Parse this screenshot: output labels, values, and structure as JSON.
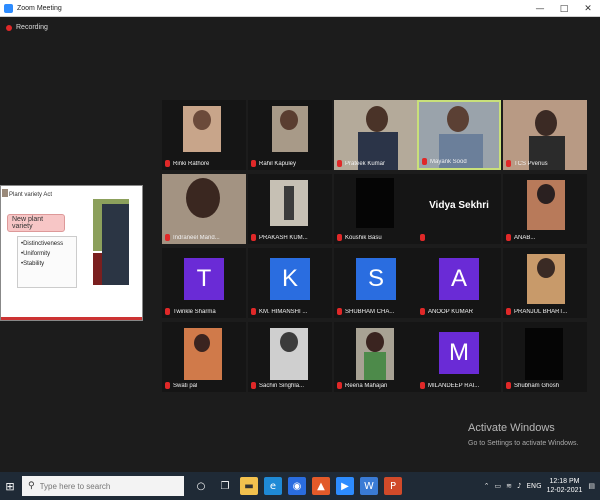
{
  "window": {
    "title": "Zoom Meeting",
    "minimize": "—",
    "maximize": "□",
    "close": "✕"
  },
  "recording": {
    "label": "Recording"
  },
  "slide": {
    "title": "Plant variety Act",
    "heading": "New plant variety",
    "points": [
      "•Distinctiveness",
      "•Uniformity",
      "•Stability"
    ]
  },
  "participants": [
    {
      "name": "Rinki Rathore"
    },
    {
      "name": "Rahil Kapuley"
    },
    {
      "name": "Prateek Kumar"
    },
    {
      "name": "Mayank Sood"
    },
    {
      "name": "TCS Pvenus"
    },
    {
      "name": "Indraneel Mand..."
    },
    {
      "name": "PRAKASH KUM..."
    },
    {
      "name": "Koushik Basu"
    },
    {
      "name": "Vidya Sekhri",
      "label": "Vidya Sekhri"
    },
    {
      "name": "ANAB..."
    },
    {
      "name": "Twinkle Sharma",
      "letter": "T"
    },
    {
      "name": "KM. HIMANSHI ...",
      "letter": "K"
    },
    {
      "name": "SHUBHAM CHA...",
      "letter": "S"
    },
    {
      "name": "ANOOP KUMAR",
      "letter": "A"
    },
    {
      "name": "PRANJUL BHART..."
    },
    {
      "name": "Swati pal"
    },
    {
      "name": "Sachin Singhla..."
    },
    {
      "name": "Reena Mahajan"
    },
    {
      "name": "MILANDEEP RAI...",
      "letter": "M"
    },
    {
      "name": "Shubham Ghosh"
    }
  ],
  "watermark": {
    "line1": "Activate Windows",
    "line2": "Go to Settings to activate Windows."
  },
  "taskbar": {
    "search_placeholder": "Type here to search",
    "lang": "ENG",
    "time": "12:18 PM",
    "date": "12-02-2021"
  },
  "colors": {
    "zoom_blue": "#2d8cff",
    "avatar_purple": "#6a2bd6",
    "avatar_blue": "#2a6de0",
    "active_border": "#c9e07a"
  }
}
